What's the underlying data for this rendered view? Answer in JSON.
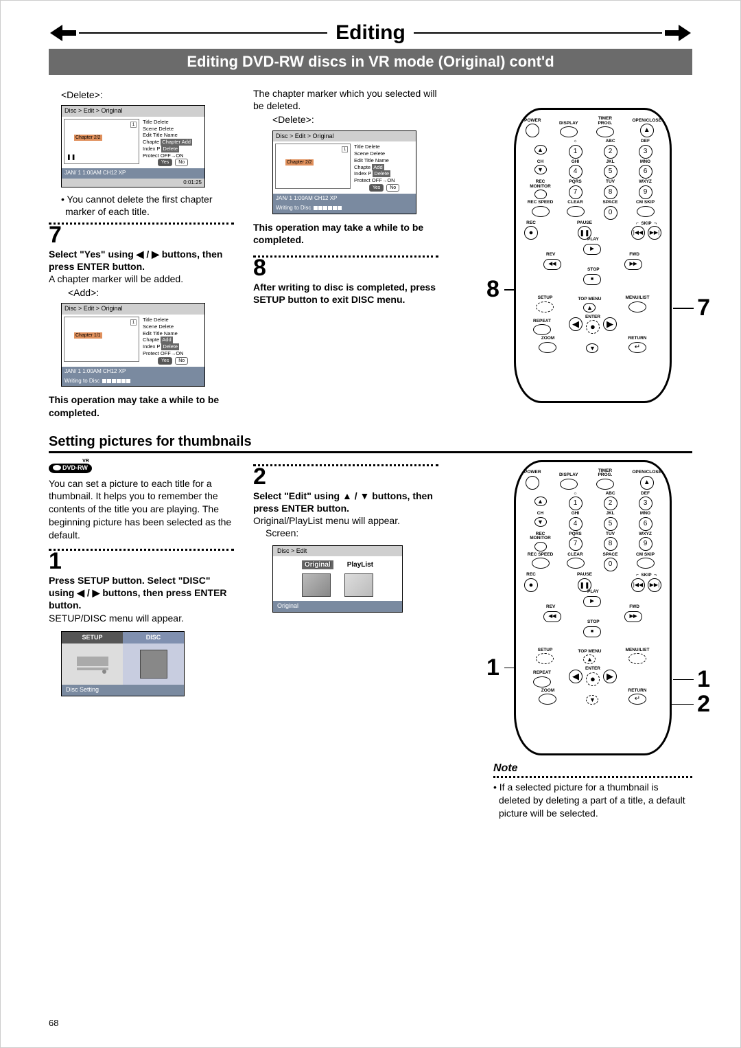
{
  "header": {
    "section": "Editing",
    "subtitle": "Editing DVD-RW discs in VR mode (Original) cont'd"
  },
  "page_number": "68",
  "top": {
    "left": {
      "tag_delete": "<Delete>:",
      "osd1": {
        "crumb": "Disc > Edit > Original",
        "chapter": "Chapter 2/2",
        "menu": [
          "Title Delete",
          "Scene Delete",
          "Edit Title Name",
          "Chapter Add",
          "Index P Delete",
          "Protect OFF→ON"
        ],
        "yes": "Yes",
        "no": "No",
        "info": "JAN/ 1   1:00AM  CH12     XP",
        "timer": "0:01:25"
      },
      "bullet1": "• You cannot delete the first chapter marker of each title.",
      "step7": "7",
      "step7_bold": "Select \"Yes\" using ◀ / ▶ buttons, then press ENTER button.",
      "step7_body": "A chapter marker will be added.",
      "tag_add": "<Add>:",
      "osd2": {
        "crumb": "Disc > Edit > Original",
        "chapter": "Chapter 1/1",
        "menu": [
          "Title Delete",
          "Scene Delete",
          "Edit Title Name",
          "Chapter Add",
          "Index P Delete",
          "Protect OFF→ON"
        ],
        "yes": "Yes",
        "no": "No",
        "info": "JAN/ 1   1:00AM  CH12     XP",
        "writing": "Writing to Disc"
      },
      "warn": "This operation may take a while to be completed."
    },
    "mid": {
      "body1": "The chapter marker which you selected will be deleted.",
      "tag_delete": "<Delete>:",
      "osd3": {
        "crumb": "Disc > Edit > Original",
        "chapter": "Chapter 2/2",
        "menu": [
          "Title Delete",
          "Scene Delete",
          "Edit Title Name",
          "Chapter Add",
          "Index P Delete",
          "Protect OFF→ON"
        ],
        "yes": "Yes",
        "no": "No",
        "info": "JAN/ 1   1:00AM  CH12     XP",
        "writing": "Writing to Disc"
      },
      "warn": "This operation may take a while to be completed.",
      "step8": "8",
      "step8_bold": "After writing to disc is completed, press SETUP button to exit DISC menu."
    },
    "remote": {
      "callouts": {
        "left": "8",
        "right": "7"
      },
      "labels": {
        "power": "POWER",
        "display": "DISPLAY",
        "timerprog": "TIMER\nPROG.",
        "openclose": "OPEN/CLOSE",
        "brightness": "☼",
        "abc": "ABC",
        "def": "DEF",
        "ch": "CH",
        "ghi": "GHI",
        "jkl": "JKL",
        "mno": "MNO",
        "recmon": "REC\nMONITOR",
        "pqrs": "PQRS",
        "tuv": "TUV",
        "wxyz": "WXYZ",
        "recspeed": "REC SPEED",
        "clear": "CLEAR",
        "space": "SPACE",
        "cmskip": "CM SKIP",
        "rec": "REC",
        "pause": "PAUSE",
        "skip": "SKIP",
        "play": "PLAY",
        "rev": "REV",
        "fwd": "FWD",
        "stop": "STOP",
        "setup": "SETUP",
        "topmenu": "TOP MENU",
        "menulist": "MENU/LIST",
        "repeat": "REPEAT",
        "enter": "ENTER",
        "zoom": "ZOOM",
        "return": "RETURN"
      },
      "digits": [
        "1",
        "2",
        "3",
        "4",
        "5",
        "6",
        "7",
        "8",
        "9",
        "0"
      ]
    }
  },
  "thumb": {
    "heading": "Setting pictures for thumbnails",
    "badge": "DVD-RW",
    "left": {
      "intro": "You can set a picture to each title for a thumbnail. It helps you to remember the contents of the title you are playing. The beginning picture has been selected as the default.",
      "step1": "1",
      "step1_bold": "Press SETUP button. Select \"DISC\" using ◀ / ▶ buttons, then press ENTER button.",
      "step1_body": "SETUP/DISC menu will appear.",
      "setup_tab": "SETUP",
      "disc_tab": "DISC",
      "setup_foot": "Disc Setting"
    },
    "mid": {
      "step2": "2",
      "step2_bold": "Select \"Edit\" using ▲ / ▼ buttons, then press ENTER button.",
      "step2_body": "Original/PlayList menu will appear.",
      "screen": "Screen:",
      "edit_crumb": "Disc > Edit",
      "original": "Original",
      "playlist": "PlayList",
      "edit_foot": "Original"
    },
    "right": {
      "callouts": {
        "left": "1",
        "right1": "1",
        "right2": "2"
      },
      "note_head": "Note",
      "note_body": "• If a selected picture for a thumbnail is deleted by deleting a part of a title, a default picture will be selected."
    }
  }
}
